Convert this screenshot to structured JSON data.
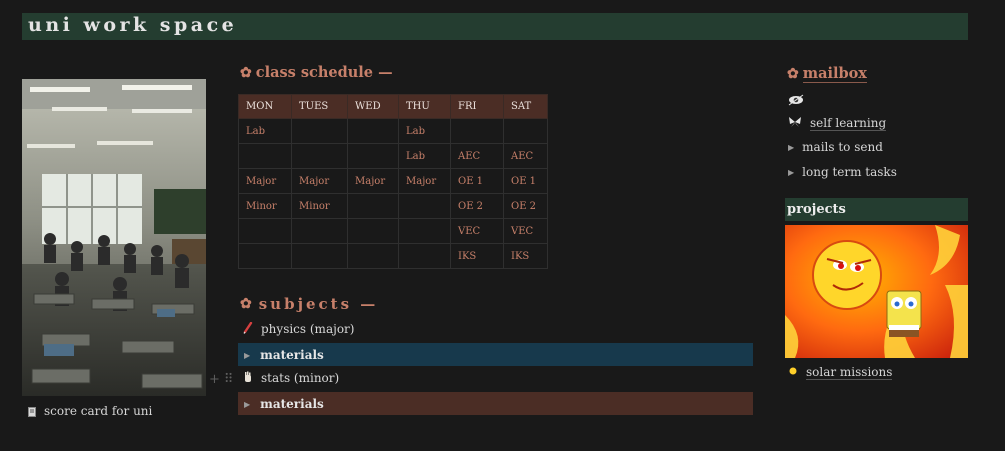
{
  "header": {
    "title": "uni work space"
  },
  "left": {
    "caption": "score card for uni",
    "caption_icon": "document-icon"
  },
  "schedule": {
    "heading": "class schedule —",
    "columns": [
      "MON",
      "TUES",
      "WED",
      "THU",
      "FRI",
      "SAT"
    ],
    "rows": [
      [
        "Lab",
        "",
        "",
        "Lab",
        "",
        ""
      ],
      [
        "",
        "",
        "",
        "Lab",
        "AEC",
        "AEC"
      ],
      [
        "Major",
        "Major",
        "Major",
        "Major",
        "OE 1",
        "OE 1"
      ],
      [
        "Minor",
        "Minor",
        "",
        "",
        "OE 2",
        "OE 2"
      ],
      [
        "",
        "",
        "",
        "",
        "VEC",
        "VEC"
      ],
      [
        "",
        "",
        "",
        "",
        "IKS",
        "IKS"
      ]
    ]
  },
  "subjects": {
    "heading": "subjects —",
    "items": [
      {
        "label": "physics (major)",
        "icon": "pen-icon",
        "toggle": "materials",
        "toggle_color": "#17394c"
      },
      {
        "label": "stats (minor)",
        "icon": "hand-icon",
        "toggle": "materials",
        "toggle_color": "#4b2d25"
      }
    ]
  },
  "mailbox": {
    "heading": "mailbox",
    "items": [
      {
        "label": "",
        "icon": "eye-icon"
      },
      {
        "label": "self learning",
        "icon": "butterfly-icon"
      },
      {
        "label": "mails to send",
        "icon": "toggle-triangle"
      },
      {
        "label": "long term tasks",
        "icon": "toggle-triangle"
      }
    ]
  },
  "projects": {
    "heading": "projects",
    "item": "solar missions",
    "item_icon": "sun-dot-icon"
  },
  "colors": {
    "accent": "#c7806a",
    "header_bg": "#243d30",
    "table_header_bg": "#4b2d25",
    "blue_toggle_bg": "#17394c",
    "page_bg": "#191919"
  }
}
